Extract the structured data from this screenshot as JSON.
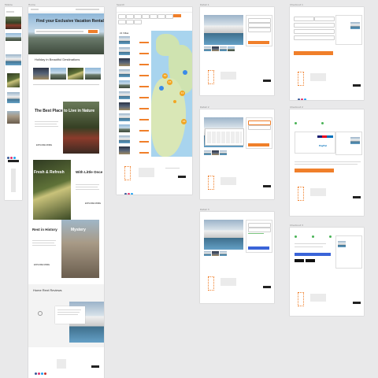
{
  "frames": {
    "labels": [
      "Mobile",
      "Home",
      "Search",
      "Detail 1",
      "Detail 2",
      "Detail 3",
      "Checkout 1",
      "Checkout 2",
      "Checkout 3"
    ]
  },
  "home": {
    "hero_title": "Find your Exclusive Vacation Rental",
    "hero_cta": "SEARCH",
    "section_title": "Holiday in Beautiful Destinations",
    "feature1_title_left": "The Best Place",
    "feature1_title_right": "to Live in Nature",
    "feature1_cta": "EXPLORE MORE",
    "feature2_title_left": "Fresh & Refresh",
    "feature2_title_right": "With Little Once",
    "feature2_cta": "EXPLORE MORE",
    "feature3_title_left": "Rest in History",
    "feature3_title_right": "Mystery",
    "feature3_cta": "EXPLORE MORE",
    "reviews_title": "Home Rent Reviews"
  },
  "search": {
    "results_count": "21 Villas",
    "clusters": [
      "30",
      "15",
      "12",
      "16",
      "10",
      "10"
    ]
  },
  "detail": {
    "book_label": "BOOK THIS HOME",
    "book_label_3": "BOOK NOW"
  },
  "checkout": {
    "pay_label": "PAY",
    "paypal_label": "PayPal",
    "confirm_label": "BOOK NOW"
  },
  "colors": {
    "accent": "#f07f2a",
    "blue": "#3a64d8",
    "map_sea": "#a8d4ee",
    "map_land": "#cfe3b0"
  }
}
